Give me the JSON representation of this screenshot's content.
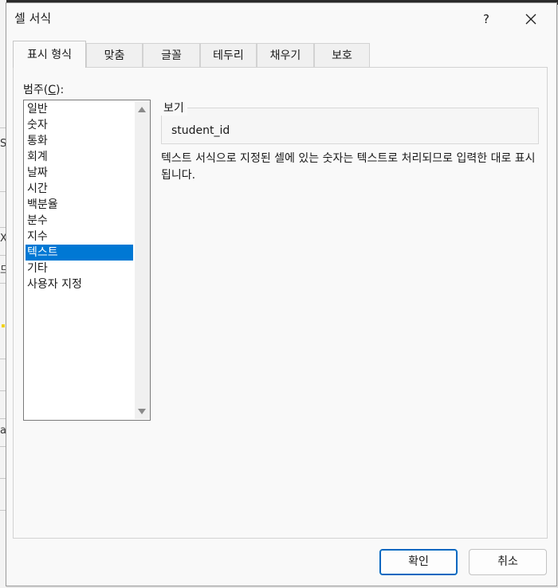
{
  "dialog": {
    "title": "셀 서식",
    "help_label": "?"
  },
  "background": {
    "chars": [
      "S",
      "X",
      "드",
      "a"
    ]
  },
  "tabs": [
    {
      "label": "표시 형식",
      "active": true
    },
    {
      "label": "맞춤"
    },
    {
      "label": "글꼴"
    },
    {
      "label": "테두리"
    },
    {
      "label": "채우기"
    },
    {
      "label": "보호"
    }
  ],
  "category": {
    "label_prefix": "범주(",
    "label_key": "C",
    "label_suffix": "):",
    "items": [
      "일반",
      "숫자",
      "통화",
      "회계",
      "날짜",
      "시간",
      "백분율",
      "분수",
      "지수",
      "텍스트",
      "기타",
      "사용자 지정"
    ],
    "selected": "텍스트"
  },
  "preview": {
    "legend": "보기",
    "value": "student_id"
  },
  "description": "텍스트 서식으로 지정된 셀에 있는 숫자는 텍스트로 처리되므로 입력한 대로 표시됩니다.",
  "buttons": {
    "ok": "확인",
    "cancel": "취소"
  }
}
